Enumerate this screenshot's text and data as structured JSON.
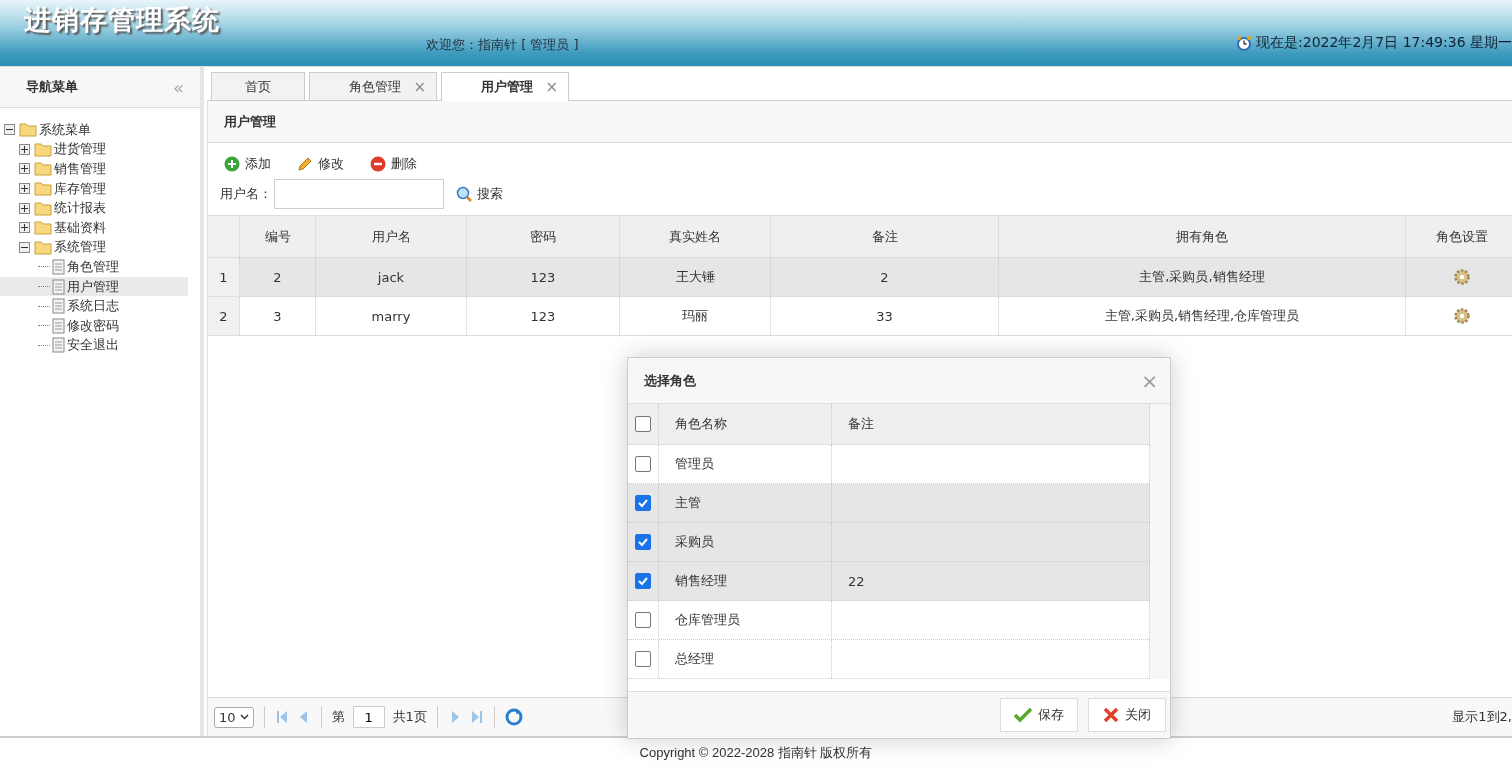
{
  "header": {
    "title": "进销存管理系统",
    "welcome": "欢迎您：指南针 [ 管理员 ]",
    "clock": "现在是:2022年2月7日 17:49:36 星期一"
  },
  "sidebar": {
    "title": "导航菜单",
    "collapse": "«",
    "tree": [
      {
        "label": "系统菜单",
        "expanded": true,
        "children": [
          {
            "label": "进货管理",
            "expanded": false
          },
          {
            "label": "销售管理",
            "expanded": false
          },
          {
            "label": "库存管理",
            "expanded": false
          },
          {
            "label": "统计报表",
            "expanded": false
          },
          {
            "label": "基础资料",
            "expanded": false
          },
          {
            "label": "系统管理",
            "expanded": true,
            "children": [
              {
                "label": "角色管理",
                "selected": false
              },
              {
                "label": "用户管理",
                "selected": true
              },
              {
                "label": "系统日志",
                "selected": false
              },
              {
                "label": "修改密码",
                "selected": false
              },
              {
                "label": "安全退出",
                "selected": false
              }
            ]
          }
        ]
      }
    ]
  },
  "tabs": [
    {
      "label": "首页",
      "selected": false,
      "closable": false
    },
    {
      "label": "角色管理",
      "selected": false,
      "closable": true
    },
    {
      "label": "用户管理",
      "selected": true,
      "closable": true
    }
  ],
  "close_glyph": "×",
  "panel": {
    "title": "用户管理",
    "toolbar": [
      {
        "kind": "add",
        "label": "添加"
      },
      {
        "kind": "edit",
        "label": "修改"
      },
      {
        "kind": "delete",
        "label": "删除"
      }
    ],
    "search": {
      "label": "用户名：",
      "button": "搜索"
    },
    "table": {
      "columns": [
        "编号",
        "用户名",
        "密码",
        "真实姓名",
        "备注",
        "拥有角色",
        "角色设置"
      ],
      "rows": [
        {
          "index": "1",
          "selected": true,
          "cells": [
            "2",
            "jack",
            "123",
            "王大锤",
            "2",
            "主管,采购员,销售经理"
          ]
        },
        {
          "index": "2",
          "selected": false,
          "cells": [
            "3",
            "marry",
            "123",
            "玛丽",
            "33",
            "主管,采购员,销售经理,仓库管理员"
          ]
        }
      ]
    },
    "pager": {
      "page_size": "10",
      "page_prefix": "第",
      "page": "1",
      "page_suffix": "共1页",
      "summary": "显示1到2,"
    }
  },
  "dialog": {
    "title": "选择角色",
    "close": "×",
    "columns": [
      "角色名称",
      "备注"
    ],
    "all_checked": false,
    "rows": [
      {
        "name": "管理员",
        "note": "",
        "checked": false
      },
      {
        "name": "主管",
        "note": "",
        "checked": true
      },
      {
        "name": "采购员",
        "note": "",
        "checked": true
      },
      {
        "name": "销售经理",
        "note": "22",
        "checked": true
      },
      {
        "name": "仓库管理员",
        "note": "",
        "checked": false
      },
      {
        "name": "总经理",
        "note": "",
        "checked": false
      }
    ],
    "buttons": [
      {
        "kind": "save",
        "label": "保存"
      },
      {
        "kind": "close",
        "label": "关闭"
      }
    ]
  },
  "footer": "Copyright © 2022-2028 指南针 版权所有"
}
